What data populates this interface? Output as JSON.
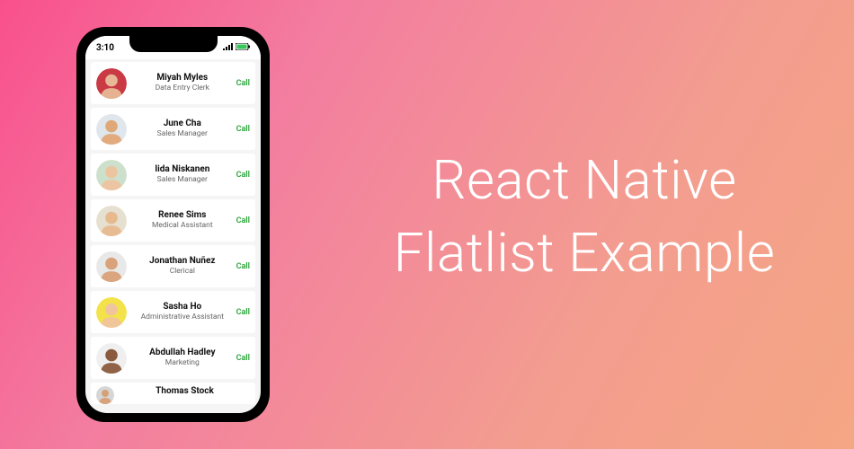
{
  "heading": "React Native\nFlatlist Example",
  "status": {
    "time": "3:10",
    "signal_icon": "signal-icon",
    "battery_icon": "battery-icon"
  },
  "call_label": "Call",
  "colors": {
    "call": "#2aa43a",
    "gradient_start": "#f9508c",
    "gradient_end": "#f5a683"
  },
  "contacts": [
    {
      "name": "Miyah Myles",
      "role": "Data Entry Clerk",
      "avatar_bg": "#c93a44",
      "avatar_skin": "#e8b896"
    },
    {
      "name": "June Cha",
      "role": "Sales Manager",
      "avatar_bg": "#dfe6ec",
      "avatar_skin": "#e0a878"
    },
    {
      "name": "Iida Niskanen",
      "role": "Sales Manager",
      "avatar_bg": "#cde0cc",
      "avatar_skin": "#edc4a0"
    },
    {
      "name": "Renee Sims",
      "role": "Medical Assistant",
      "avatar_bg": "#e6e0d0",
      "avatar_skin": "#e7b98f"
    },
    {
      "name": "Jonathan Nuñez",
      "role": "Clerical",
      "avatar_bg": "#e8e8e8",
      "avatar_skin": "#d9a27a"
    },
    {
      "name": "Sasha Ho",
      "role": "Administrative Assistant",
      "avatar_bg": "#f4e24a",
      "avatar_skin": "#f0c49d"
    },
    {
      "name": "Abdullah Hadley",
      "role": "Marketing",
      "avatar_bg": "#efefef",
      "avatar_skin": "#8a5a3e"
    },
    {
      "name": "Thomas Stock",
      "role": "",
      "avatar_bg": "#d6d6d6",
      "avatar_skin": "#d6a077"
    }
  ]
}
